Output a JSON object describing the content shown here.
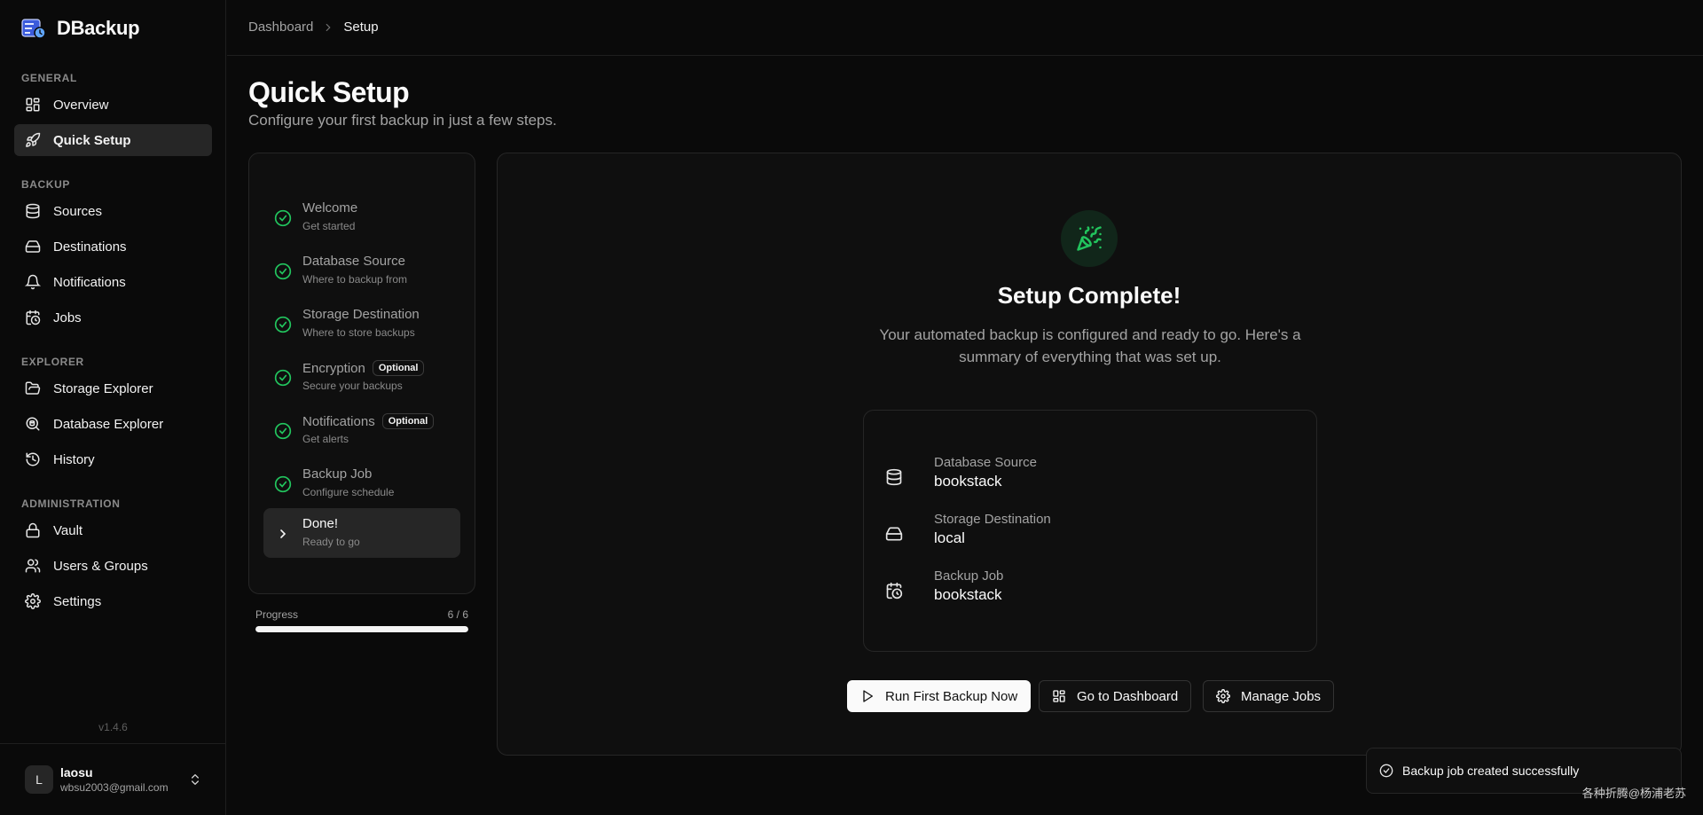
{
  "app": {
    "name": "DBackup",
    "version": "v1.4.6",
    "accent_color": "#22c55e"
  },
  "sidebar": {
    "groups": [
      {
        "label": "GENERAL",
        "items": [
          {
            "label": "Overview",
            "icon": "layout-grid-icon"
          },
          {
            "label": "Quick Setup",
            "icon": "rocket-icon",
            "active": true
          }
        ]
      },
      {
        "label": "BACKUP",
        "items": [
          {
            "label": "Sources",
            "icon": "database-icon"
          },
          {
            "label": "Destinations",
            "icon": "hard-drive-icon"
          },
          {
            "label": "Notifications",
            "icon": "bell-icon"
          },
          {
            "label": "Jobs",
            "icon": "calendar-clock-icon"
          }
        ]
      },
      {
        "label": "EXPLORER",
        "items": [
          {
            "label": "Storage Explorer",
            "icon": "folder-open-icon"
          },
          {
            "label": "Database Explorer",
            "icon": "search-database-icon"
          },
          {
            "label": "History",
            "icon": "history-icon"
          }
        ]
      },
      {
        "label": "ADMINISTRATION",
        "items": [
          {
            "label": "Vault",
            "icon": "lock-icon"
          },
          {
            "label": "Users & Groups",
            "icon": "users-icon"
          },
          {
            "label": "Settings",
            "icon": "gear-icon"
          }
        ]
      }
    ]
  },
  "user": {
    "initial": "L",
    "name": "laosu",
    "email": "wbsu2003@gmail.com"
  },
  "breadcrumb": {
    "parent": "Dashboard",
    "current": "Setup"
  },
  "page": {
    "title": "Quick Setup",
    "subtitle": "Configure your first backup in just a few steps."
  },
  "steps": [
    {
      "title": "Welcome",
      "subtitle": "Get started",
      "status": "complete"
    },
    {
      "title": "Database Source",
      "subtitle": "Where to backup from",
      "status": "complete"
    },
    {
      "title": "Storage Destination",
      "subtitle": "Where to store backups",
      "status": "complete"
    },
    {
      "title": "Encryption",
      "subtitle": "Secure your backups",
      "status": "complete",
      "badge": "Optional"
    },
    {
      "title": "Notifications",
      "subtitle": "Get alerts",
      "status": "complete",
      "badge": "Optional"
    },
    {
      "title": "Backup Job",
      "subtitle": "Configure schedule",
      "status": "complete"
    },
    {
      "title": "Done!",
      "subtitle": "Ready to go",
      "status": "current"
    }
  ],
  "progress": {
    "label": "Progress",
    "text": "6 / 6",
    "fraction": 1.0
  },
  "complete": {
    "title": "Setup Complete!",
    "description": "Your automated backup is configured and ready to go. Here's a summary of everything that was set up.",
    "summary": [
      {
        "label": "Database Source",
        "value": "bookstack",
        "icon": "database-icon"
      },
      {
        "label": "Storage Destination",
        "value": "local",
        "icon": "hard-drive-icon"
      },
      {
        "label": "Backup Job",
        "value": "bookstack",
        "icon": "calendar-clock-icon"
      }
    ],
    "actions": {
      "run_first": "Run First Backup Now",
      "dashboard": "Go to Dashboard",
      "manage_jobs": "Manage Jobs"
    }
  },
  "toast": {
    "message": "Backup job created successfully"
  },
  "watermark": "各种折腾@杨浦老苏"
}
